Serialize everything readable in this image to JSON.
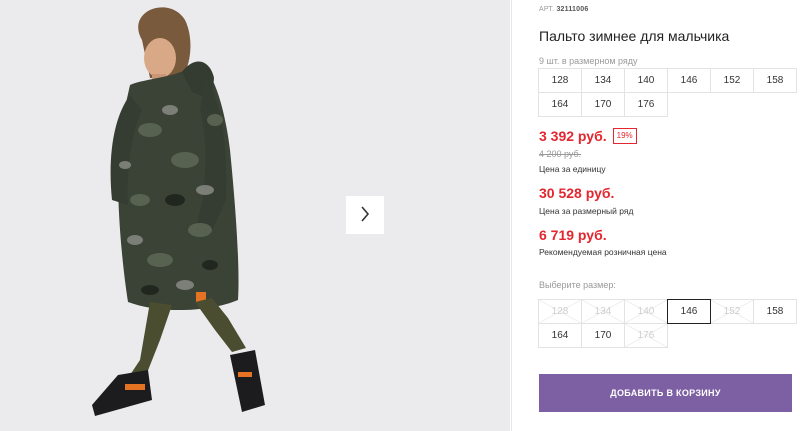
{
  "product": {
    "sku_label": "АРТ.",
    "sku_value": "32111006",
    "title": "Пальто зимнее для мальчика"
  },
  "size_range": {
    "label": "9 шт. в размерном ряду",
    "sizes": [
      "128",
      "134",
      "140",
      "146",
      "152",
      "158",
      "164",
      "170",
      "176"
    ]
  },
  "prices": {
    "unit_price": "3 392 руб.",
    "discount": "19%",
    "old_price": "4 200 руб.",
    "unit_label": "Цена за единицу",
    "range_price": "30 528 руб.",
    "range_label": "Цена за размерный ряд",
    "rrp_price": "6 719 руб.",
    "rrp_label": "Рекомендуемая розничная цена"
  },
  "size_picker": {
    "label": "Выберите размер:",
    "options": [
      {
        "size": "128",
        "available": false
      },
      {
        "size": "134",
        "available": false
      },
      {
        "size": "140",
        "available": false
      },
      {
        "size": "146",
        "available": true,
        "selected": true
      },
      {
        "size": "152",
        "available": false
      },
      {
        "size": "158",
        "available": true
      },
      {
        "size": "164",
        "available": true
      },
      {
        "size": "170",
        "available": true
      },
      {
        "size": "176",
        "available": false
      }
    ]
  },
  "actions": {
    "add_to_cart": "ДОБАВИТЬ В КОРЗИНУ"
  },
  "icons": {
    "gallery_next": "chevron-right-icon"
  },
  "colors": {
    "price_red": "#e3262f",
    "button_purple": "#7d5fa3"
  }
}
